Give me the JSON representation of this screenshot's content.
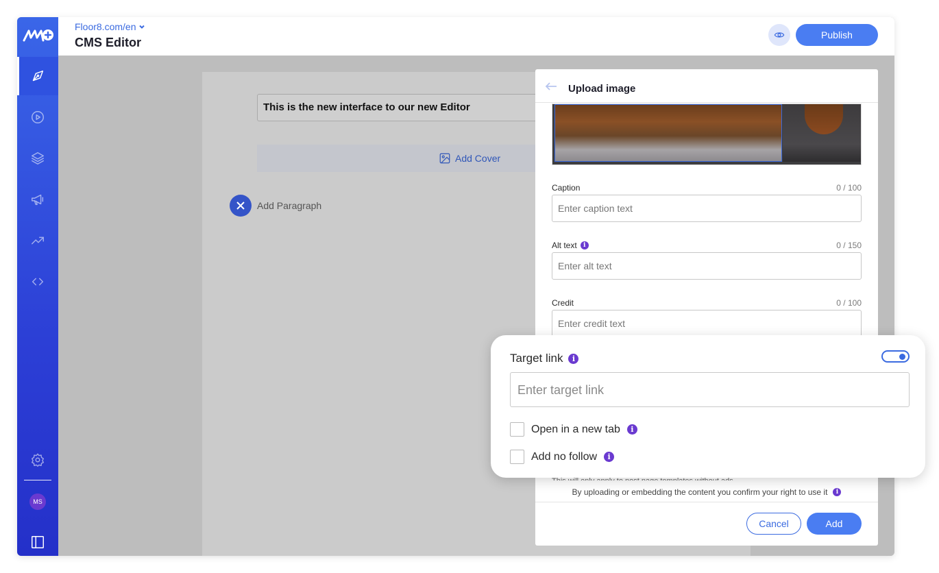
{
  "header": {
    "site": "Floor8.com/en",
    "title": "CMS Editor",
    "publish_label": "Publish"
  },
  "sidebar": {
    "avatar_initials": "MS",
    "items": [
      "feather-pen-icon",
      "play-circle-icon",
      "layers-icon",
      "megaphone-icon",
      "trending-up-icon",
      "code-icon"
    ]
  },
  "editor": {
    "title_value": "This is the new interface to our new Editor",
    "add_cover_label": "Add Cover",
    "add_paragraph_label": "Add Paragraph"
  },
  "upload_panel": {
    "title": "Upload image",
    "caption": {
      "label": "Caption",
      "count": "0 / 100",
      "placeholder": "Enter caption text"
    },
    "alt_text": {
      "label": "Alt text",
      "count": "0 / 150",
      "placeholder": "Enter alt text"
    },
    "credit": {
      "label": "Credit",
      "count": "0 / 100",
      "placeholder": "Enter credit text"
    },
    "hidden_note": "This will only apply to post page templates without ads",
    "confirm_note": "By uploading or embedding the content you confirm your right to use it",
    "cancel_label": "Cancel",
    "add_label": "Add"
  },
  "target_link": {
    "title": "Target link",
    "placeholder": "Enter target link",
    "toggle_on": true,
    "open_new_tab_label": "Open in a new tab",
    "no_follow_label": "Add no follow"
  },
  "colors": {
    "accent": "#4a7df2",
    "info": "#6a3ad0",
    "sidebar_top": "#3a66e8",
    "sidebar_bottom": "#2430c9"
  }
}
